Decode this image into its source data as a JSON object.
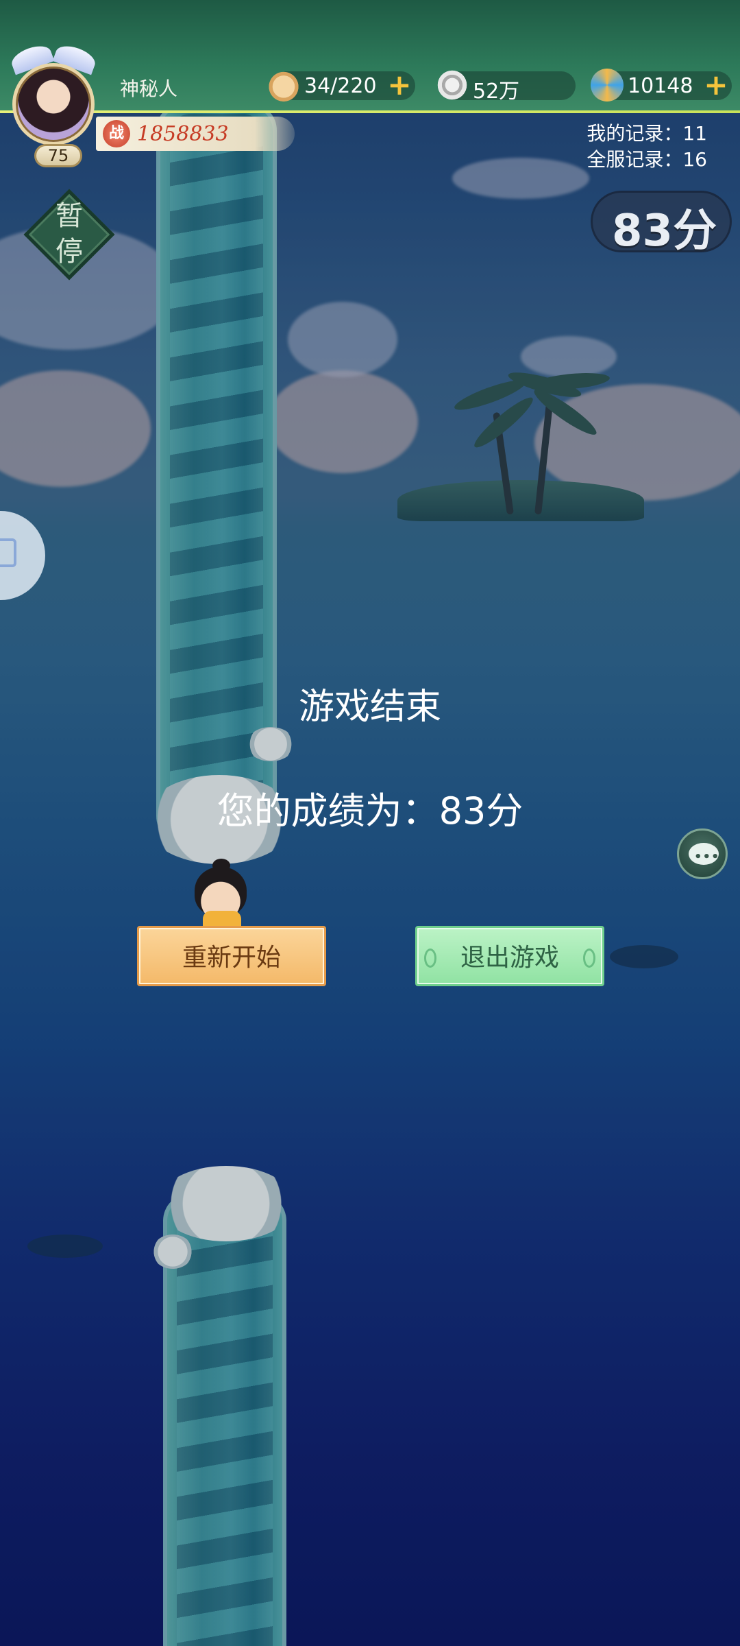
{
  "player": {
    "name": "神秘人",
    "level": "75",
    "power_icon": "战",
    "power": "1858833"
  },
  "resources": {
    "stamina": "34/220",
    "silver": "52万",
    "gold": "10148",
    "plus": "+"
  },
  "records": {
    "mine": "我的记录：11",
    "server": "全服记录：16"
  },
  "score_display": "83分",
  "pause_label_1": "暂",
  "pause_label_2": "停",
  "game_over": {
    "title": "游戏结束",
    "result": "您的成绩为：83分",
    "restart_label": "重新开始",
    "exit_label": "退出游戏"
  },
  "icons": {
    "stamina": "steamed-bun-icon",
    "silver": "coin-icon",
    "gold": "swirl-gem-icon",
    "chat": "chat-bubble-icon"
  },
  "colors": {
    "restart_button": "#f4b969",
    "exit_button": "#90e2a3",
    "power_text": "#c63b24",
    "topbar": "#2d7a5a"
  }
}
